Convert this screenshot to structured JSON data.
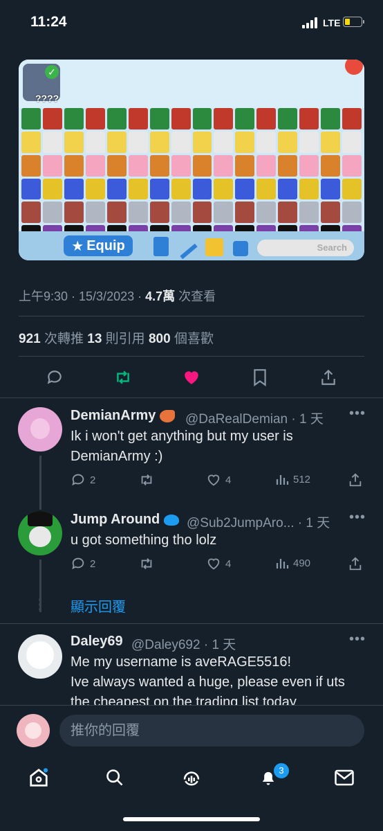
{
  "status_bar": {
    "time": "11:24",
    "network": "LTE"
  },
  "tweet": {
    "image_text": {
      "equip_label": "Equip",
      "search_placeholder": "Search",
      "pet_label": "????"
    },
    "timestamp": "上午9:30 · 15/3/2023 · ",
    "views_count": "4.7萬",
    "views_label": " 次查看",
    "stats": {
      "retweets_count": "921",
      "retweets_label": " 次轉推  ",
      "quotes_count": "13",
      "quotes_label": " 則引用  ",
      "likes_count": "800",
      "likes_label": " 個喜歡"
    }
  },
  "replies": [
    {
      "name": "DemianArmy",
      "handle": "@DaRealDemian · 1 天",
      "text": "Ik i won't get anything but my user is DemianArmy :)",
      "replies": "2",
      "likes": "4",
      "views": "512"
    },
    {
      "name": "Jump Around",
      "handle": "@Sub2JumpAro... · 1 天",
      "text": "u got something tho lolz",
      "replies": "2",
      "likes": "4",
      "views": "490"
    },
    {
      "name": "Daley69",
      "handle": "@Daley692 · 1 天",
      "text": "Me my username is aveRAGE5516!\nIve always wanted a huge, please even if uts the cheapest on the trading list today",
      "replies": "",
      "likes": "",
      "views": ""
    }
  ],
  "show_replies_label": "顯示回覆",
  "composer_placeholder": "推你的回覆",
  "tabbar": {
    "notifications_badge": "3"
  },
  "colors": {
    "background": "#15202b",
    "accent": "#1d9bf0",
    "like": "#f91880",
    "retweet": "#00ba7c"
  }
}
